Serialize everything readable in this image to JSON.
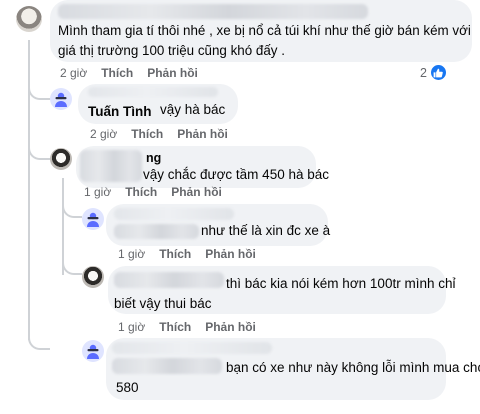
{
  "icons": {
    "like_badge": "like-thumb-icon",
    "generic_avatar": "person-silhouette-icon"
  },
  "colors": {
    "link_blue": "#1877f2",
    "bubble_bg": "#f0f2f5",
    "meta_gray": "#65676b"
  },
  "comments": [
    {
      "line1": "Mình tham gia tí thôi nhé , xe bị nổ cả túi khí như thế giờ bán kém với",
      "line2": "giá thị trường 100 triệu cũng khó đấy .",
      "time": "2 giờ",
      "like": "Thích",
      "reply": "Phản hồi",
      "reaction_count": "2"
    },
    {
      "name": "Tuấn Tình",
      "text": "vậy hà bác",
      "time": "2 giờ",
      "like": "Thích",
      "reply": "Phản hồi"
    },
    {
      "name_partial": "ng",
      "text": "vậy chắc được tầm 450 hà bác",
      "time": "1 giờ",
      "like": "Thích",
      "reply": "Phản hồi"
    },
    {
      "text": "như thế là xin đc xe à",
      "time": "1 giờ",
      "like": "Thích",
      "reply": "Phản hồi"
    },
    {
      "line1": "thì bác kia nói kém hơn 100tr mình chỉ",
      "line2": "biết vậy thui bác",
      "time": "1 giờ",
      "like": "Thích",
      "reply": "Phản hồi"
    },
    {
      "line1": "bạn có xe như này không lỗi mình mua cho",
      "line2": "580"
    }
  ]
}
